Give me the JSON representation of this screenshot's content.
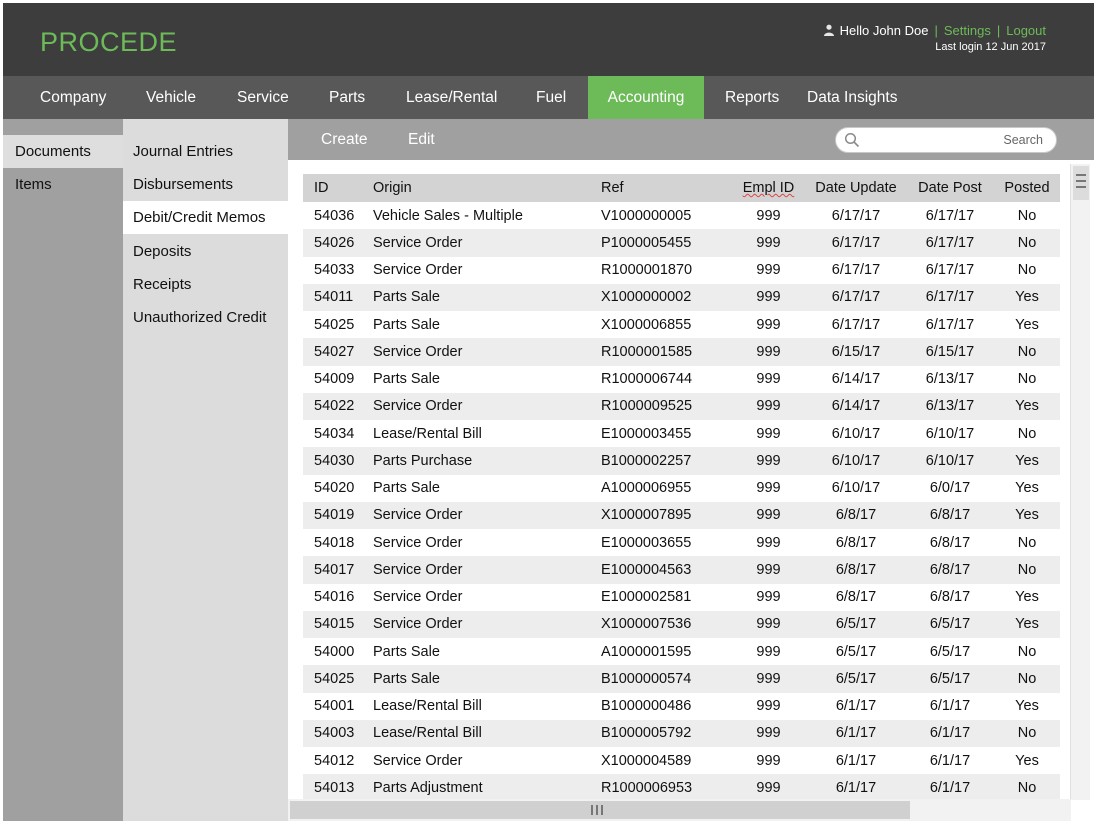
{
  "app": {
    "logo": "PROCEDE"
  },
  "user": {
    "greeting": "Hello John Doe",
    "settings_label": "Settings",
    "logout_label": "Logout",
    "separator": "|",
    "last_login": "Last login 12 Jun 2017"
  },
  "mainnav": {
    "items": [
      {
        "label": "Company"
      },
      {
        "label": "Vehicle"
      },
      {
        "label": "Service"
      },
      {
        "label": "Parts"
      },
      {
        "label": "Lease/Rental"
      },
      {
        "label": "Fuel"
      },
      {
        "label": "Accounting",
        "active": true
      },
      {
        "label": "Reports"
      },
      {
        "label": "Data Insights"
      }
    ]
  },
  "sidebar": {
    "items": [
      {
        "label": "Documents",
        "active": true
      },
      {
        "label": "Items"
      }
    ]
  },
  "submenu": {
    "items": [
      {
        "label": "Journal Entries"
      },
      {
        "label": "Disbursements"
      },
      {
        "label": "Debit/Credit Memos",
        "active": true
      },
      {
        "label": "Deposits"
      },
      {
        "label": "Receipts"
      },
      {
        "label": "Unauthorized Credit"
      }
    ]
  },
  "toolbar": {
    "create_label": "Create",
    "edit_label": "Edit",
    "search_label": "Search",
    "search_value": "",
    "search_placeholder": ""
  },
  "table": {
    "columns": [
      "ID",
      "Origin",
      "Ref",
      "Empl ID",
      "Date Update",
      "Date Post",
      "Posted"
    ],
    "rows": [
      [
        "54036",
        "Vehicle Sales - Multiple",
        "V1000000005",
        "999",
        "6/17/17",
        "6/17/17",
        "No"
      ],
      [
        "54026",
        "Service Order",
        "P1000005455",
        "999",
        "6/17/17",
        "6/17/17",
        "No"
      ],
      [
        "54033",
        "Service Order",
        "R1000001870",
        "999",
        "6/17/17",
        "6/17/17",
        "No"
      ],
      [
        "54011",
        "Parts Sale",
        "X1000000002",
        "999",
        "6/17/17",
        "6/17/17",
        "Yes"
      ],
      [
        "54025",
        "Parts Sale",
        "X1000006855",
        "999",
        "6/17/17",
        "6/17/17",
        "Yes"
      ],
      [
        "54027",
        "Service Order",
        "R1000001585",
        "999",
        "6/15/17",
        "6/15/17",
        "No"
      ],
      [
        "54009",
        "Parts Sale",
        "R1000006744",
        "999",
        "6/14/17",
        "6/13/17",
        "No"
      ],
      [
        "54022",
        "Service Order",
        "R1000009525",
        "999",
        "6/14/17",
        "6/13/17",
        "Yes"
      ],
      [
        "54034",
        "Lease/Rental Bill",
        "E1000003455",
        "999",
        "6/10/17",
        "6/10/17",
        "No"
      ],
      [
        "54030",
        "Parts Purchase",
        "B1000002257",
        "999",
        "6/10/17",
        "6/10/17",
        "Yes"
      ],
      [
        "54020",
        "Parts Sale",
        "A1000006955",
        "999",
        "6/10/17",
        "6/0/17",
        "Yes"
      ],
      [
        "54019",
        "Service Order",
        "X1000007895",
        "999",
        "6/8/17",
        "6/8/17",
        "Yes"
      ],
      [
        "54018",
        "Service Order",
        "E1000003655",
        "999",
        "6/8/17",
        "6/8/17",
        "No"
      ],
      [
        "54017",
        "Service Order",
        "E1000004563",
        "999",
        "6/8/17",
        "6/8/17",
        "No"
      ],
      [
        "54016",
        "Service Order",
        "E1000002581",
        "999",
        "6/8/17",
        "6/8/17",
        "Yes"
      ],
      [
        "54015",
        "Service Order",
        "X1000007536",
        "999",
        "6/5/17",
        "6/5/17",
        "Yes"
      ],
      [
        "54000",
        "Parts Sale",
        "A1000001595",
        "999",
        "6/5/17",
        "6/5/17",
        "No"
      ],
      [
        "54025",
        "Parts Sale",
        "B1000000574",
        "999",
        "6/5/17",
        "6/5/17",
        "No"
      ],
      [
        "54001",
        "Lease/Rental Bill",
        "B1000000486",
        "999",
        "6/1/17",
        "6/1/17",
        "Yes"
      ],
      [
        "54003",
        "Lease/Rental Bill",
        "B1000005792",
        "999",
        "6/1/17",
        "6/1/17",
        "No"
      ],
      [
        "54012",
        "Service Order",
        "X1000004589",
        "999",
        "6/1/17",
        "6/1/17",
        "Yes"
      ],
      [
        "54013",
        "Parts Adjustment",
        "R1000006953",
        "999",
        "6/1/17",
        "6/1/17",
        "No"
      ]
    ]
  },
  "icons": {
    "user": "user-icon",
    "search": "search-icon",
    "vscroll_grip": "grip-lines-icon",
    "hscroll_grip": "grip-bars-icon"
  },
  "colors": {
    "accent": "#6dbb58",
    "header_bg": "#3d3d3d",
    "nav_bg": "#585858",
    "sidebar_bg": "#a0a0a0",
    "submenu_bg": "#dcdcdc",
    "toolbar_bg": "#a0a0a0",
    "row_alt": "#ededed",
    "table_header_bg": "#d3d3d3"
  }
}
